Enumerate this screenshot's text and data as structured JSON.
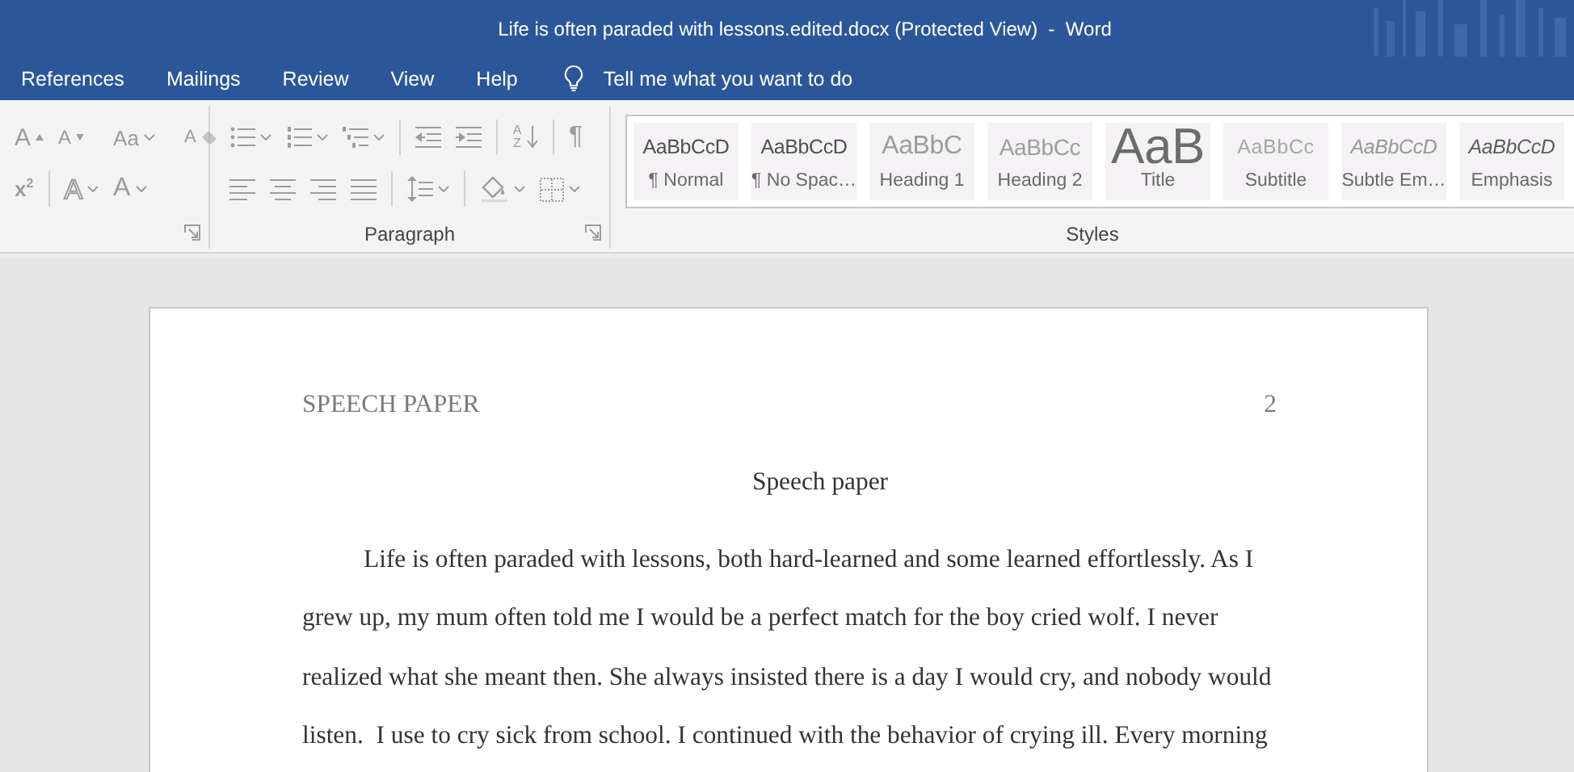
{
  "window": {
    "title": "Life is often paraded with lessons.edited.docx (Protected View)  -  Word"
  },
  "menu_tabs": [
    {
      "label": "References",
      "selected": false
    },
    {
      "label": "Mailings",
      "selected": false
    },
    {
      "label": "Review",
      "selected": false
    },
    {
      "label": "View",
      "selected": false
    },
    {
      "label": "Help",
      "selected": false
    }
  ],
  "tell_me": {
    "label": "Tell me what you want to do"
  },
  "ribbon": {
    "disabled": true,
    "groups": [
      {
        "kind": "tools",
        "launcher": true,
        "rows": [
          [
            {
              "kind": "grow-font",
              "glyph": "A",
              "dropdown": false
            },
            {
              "kind": "shrink-font",
              "glyph": "A",
              "dropdown": false
            },
            {
              "kind": "separator"
            },
            {
              "kind": "change-case",
              "glyph": "Aa",
              "dropdown": true
            },
            {
              "kind": "separator"
            },
            {
              "kind": "clear-formatting",
              "glyph": "A",
              "dropdown": false
            }
          ],
          [
            {
              "kind": "superscript",
              "glyph": "x$^{2}$",
              "dropdown": false
            },
            {
              "kind": "separator"
            },
            {
              "kind": "text-effects",
              "glyph": "A",
              "dropdown": true
            },
            {
              "kind": "font-color",
              "glyph": "A",
              "dropdown": true
            }
          ]
        ]
      },
      {
        "kind": "tools",
        "label": "Paragraph",
        "launcher": true,
        "rows": [
          [
            {
              "kind": "bullets",
              "dropdown": true
            },
            {
              "kind": "numbering",
              "dropdown": true
            },
            {
              "kind": "multilevel",
              "dropdown": true
            },
            {
              "kind": "separator"
            },
            {
              "kind": "decrease-indent",
              "dropdown": false
            },
            {
              "kind": "increase-indent",
              "dropdown": false
            },
            {
              "kind": "separator"
            },
            {
              "kind": "sort",
              "glyph": "AZ",
              "dropdown": false
            },
            {
              "kind": "separator"
            },
            {
              "kind": "show-marks",
              "glyph": "¶",
              "dropdown": false
            }
          ],
          [
            {
              "kind": "align-left",
              "dropdown": false
            },
            {
              "kind": "align-center",
              "dropdown": false
            },
            {
              "kind": "align-right",
              "dropdown": false
            },
            {
              "kind": "justify",
              "dropdown": false
            },
            {
              "kind": "separator"
            },
            {
              "kind": "line-spacing",
              "dropdown": true
            },
            {
              "kind": "separator"
            },
            {
              "kind": "shading",
              "dropdown": true
            },
            {
              "kind": "borders",
              "dropdown": true
            }
          ]
        ]
      },
      {
        "kind": "styles",
        "label": "Styles",
        "styles": [
          {
            "kind": "normal",
            "preview": "AaBbCcD",
            "label": "¶ Normal",
            "selected": false
          },
          {
            "kind": "no-spacing",
            "preview": "AaBbCcD",
            "label": "¶ No Spac…",
            "selected": false
          },
          {
            "kind": "heading-1",
            "preview": "AaBbC",
            "label": "Heading 1",
            "selected": false
          },
          {
            "kind": "heading-2",
            "preview": "AaBbCc",
            "label": "Heading 2",
            "selected": false
          },
          {
            "kind": "title",
            "preview": "AaB",
            "label": "Title",
            "selected": false
          },
          {
            "kind": "subtitle",
            "preview": "AaBbCc",
            "label": "Subtitle",
            "selected": false
          },
          {
            "kind": "subtle-emphasis",
            "preview": "AaBbCcD",
            "label": "Subtle Em…",
            "selected": false
          },
          {
            "kind": "emphasis",
            "preview": "AaBbCcD",
            "label": "Emphasis",
            "selected": false
          }
        ]
      }
    ]
  },
  "document": {
    "running_head": "SPEECH PAPER",
    "page_number": "2",
    "title": "Speech paper",
    "paragraphs": [
      "Life is often paraded with lessons, both hard-learned and some learned effortlessly. As I grew up, my mum often told me I would be a perfect match for the boy cried wolf. I never realized what she meant then. She always insisted there is a day I would cry, and nobody would listen.  I use to cry sick from school. I continued with the behavior of crying ill. Every morning"
    ]
  }
}
